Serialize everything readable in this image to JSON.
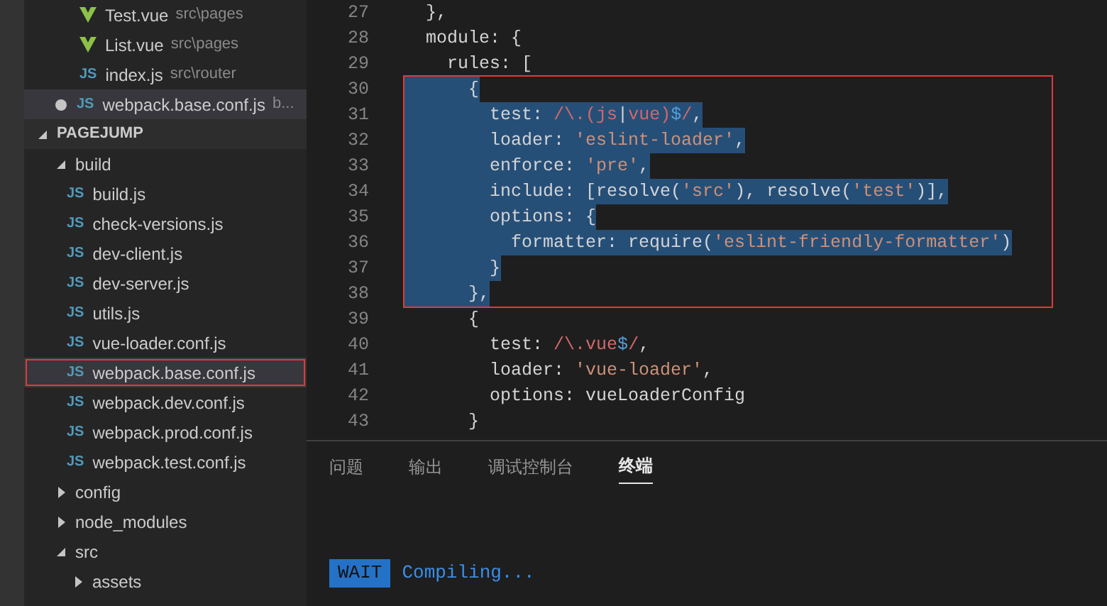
{
  "open_editors": [
    {
      "kind": "vue",
      "name": "Test.vue",
      "description": "src\\pages",
      "dirty": false,
      "selected": false
    },
    {
      "kind": "vue",
      "name": "List.vue",
      "description": "src\\pages",
      "dirty": false,
      "selected": false
    },
    {
      "kind": "js",
      "icon_label": "JS",
      "name": "index.js",
      "description": "src\\router",
      "dirty": false,
      "selected": false
    },
    {
      "kind": "js",
      "icon_label": "JS",
      "name": "webpack.base.conf.js",
      "description": "b...",
      "dirty": true,
      "selected": true
    }
  ],
  "explorer": {
    "title": "PAGEJUMP",
    "expanded": true,
    "tree": [
      {
        "kind": "folder",
        "name": "build",
        "expanded": true,
        "children": [
          {
            "kind": "js",
            "icon_label": "JS",
            "name": "build.js",
            "selected": false,
            "outlined": false
          },
          {
            "kind": "js",
            "icon_label": "JS",
            "name": "check-versions.js",
            "selected": false,
            "outlined": false
          },
          {
            "kind": "js",
            "icon_label": "JS",
            "name": "dev-client.js",
            "selected": false,
            "outlined": false
          },
          {
            "kind": "js",
            "icon_label": "JS",
            "name": "dev-server.js",
            "selected": false,
            "outlined": false
          },
          {
            "kind": "js",
            "icon_label": "JS",
            "name": "utils.js",
            "selected": false,
            "outlined": false
          },
          {
            "kind": "js",
            "icon_label": "JS",
            "name": "vue-loader.conf.js",
            "selected": false,
            "outlined": false
          },
          {
            "kind": "js",
            "icon_label": "JS",
            "name": "webpack.base.conf.js",
            "selected": true,
            "outlined": true
          },
          {
            "kind": "js",
            "icon_label": "JS",
            "name": "webpack.dev.conf.js",
            "selected": false,
            "outlined": false
          },
          {
            "kind": "js",
            "icon_label": "JS",
            "name": "webpack.prod.conf.js",
            "selected": false,
            "outlined": false
          },
          {
            "kind": "js",
            "icon_label": "JS",
            "name": "webpack.test.conf.js",
            "selected": false,
            "outlined": false
          }
        ]
      },
      {
        "kind": "folder",
        "name": "config",
        "expanded": false
      },
      {
        "kind": "folder",
        "name": "node_modules",
        "expanded": false
      },
      {
        "kind": "folder",
        "name": "src",
        "expanded": true,
        "children": [
          {
            "kind": "folder",
            "name": "assets",
            "expanded": false
          }
        ]
      }
    ]
  },
  "editor": {
    "blocks": [
      {
        "framed": false,
        "lines": [
          {
            "number": "27",
            "selected": false,
            "tokens": [
              {
                "kind": "plain",
                "text": "  },"
              }
            ]
          },
          {
            "number": "28",
            "selected": false,
            "tokens": [
              {
                "kind": "plain",
                "text": "  module: {"
              }
            ]
          },
          {
            "number": "29",
            "selected": false,
            "tokens": [
              {
                "kind": "plain",
                "text": "    rules: ["
              }
            ]
          }
        ]
      },
      {
        "framed": true,
        "lines": [
          {
            "number": "30",
            "selected": true,
            "tokens": [
              {
                "kind": "plain",
                "text": "      {"
              }
            ]
          },
          {
            "number": "31",
            "selected": true,
            "tokens": [
              {
                "kind": "plain",
                "text": "        test: "
              },
              {
                "kind": "regex",
                "text": "/\\.(js"
              },
              {
                "kind": "plain",
                "text": "|"
              },
              {
                "kind": "regex",
                "text": "vue)"
              },
              {
                "kind": "anchor",
                "text": "$"
              },
              {
                "kind": "regex",
                "text": "/"
              },
              {
                "kind": "plain",
                "text": ","
              }
            ]
          },
          {
            "number": "32",
            "selected": true,
            "tokens": [
              {
                "kind": "plain",
                "text": "        loader: "
              },
              {
                "kind": "string",
                "text": "'eslint-loader'"
              },
              {
                "kind": "plain",
                "text": ","
              }
            ]
          },
          {
            "number": "33",
            "selected": true,
            "tokens": [
              {
                "kind": "plain",
                "text": "        enforce: "
              },
              {
                "kind": "string",
                "text": "'pre'"
              },
              {
                "kind": "plain",
                "text": ","
              }
            ]
          },
          {
            "number": "34",
            "selected": true,
            "tokens": [
              {
                "kind": "plain",
                "text": "        include: [resolve("
              },
              {
                "kind": "string",
                "text": "'src'"
              },
              {
                "kind": "plain",
                "text": "), resolve("
              },
              {
                "kind": "string",
                "text": "'test'"
              },
              {
                "kind": "plain",
                "text": ")],"
              }
            ]
          },
          {
            "number": "35",
            "selected": true,
            "tokens": [
              {
                "kind": "plain",
                "text": "        options: {"
              }
            ]
          },
          {
            "number": "36",
            "selected": true,
            "tokens": [
              {
                "kind": "plain",
                "text": "          formatter: require("
              },
              {
                "kind": "string",
                "text": "'eslint-friendly-formatter'"
              },
              {
                "kind": "plain",
                "text": ")"
              }
            ]
          },
          {
            "number": "37",
            "selected": true,
            "tokens": [
              {
                "kind": "plain",
                "text": "        }"
              }
            ]
          },
          {
            "number": "38",
            "selected": true,
            "tokens": [
              {
                "kind": "plain",
                "text": "      },"
              }
            ]
          }
        ]
      },
      {
        "framed": false,
        "lines": [
          {
            "number": "39",
            "selected": false,
            "tokens": [
              {
                "kind": "plain",
                "text": "      {"
              }
            ]
          },
          {
            "number": "40",
            "selected": false,
            "tokens": [
              {
                "kind": "plain",
                "text": "        test: "
              },
              {
                "kind": "regex",
                "text": "/\\.vue"
              },
              {
                "kind": "anchor",
                "text": "$"
              },
              {
                "kind": "regex",
                "text": "/"
              },
              {
                "kind": "plain",
                "text": ","
              }
            ]
          },
          {
            "number": "41",
            "selected": false,
            "tokens": [
              {
                "kind": "plain",
                "text": "        loader: "
              },
              {
                "kind": "string",
                "text": "'vue-loader'"
              },
              {
                "kind": "plain",
                "text": ","
              }
            ]
          },
          {
            "number": "42",
            "selected": false,
            "tokens": [
              {
                "kind": "plain",
                "text": "        options: vueLoaderConfig"
              }
            ]
          },
          {
            "number": "43",
            "selected": false,
            "tokens": [
              {
                "kind": "plain",
                "text": "      }"
              }
            ]
          }
        ]
      }
    ]
  },
  "panel": {
    "tabs": [
      {
        "label": "问题",
        "selected": false
      },
      {
        "label": "输出",
        "selected": false
      },
      {
        "label": "调试控制台",
        "selected": false
      },
      {
        "label": "终端",
        "selected": true
      }
    ],
    "terminal": {
      "badge": "WAIT",
      "text": "Compiling..."
    }
  }
}
